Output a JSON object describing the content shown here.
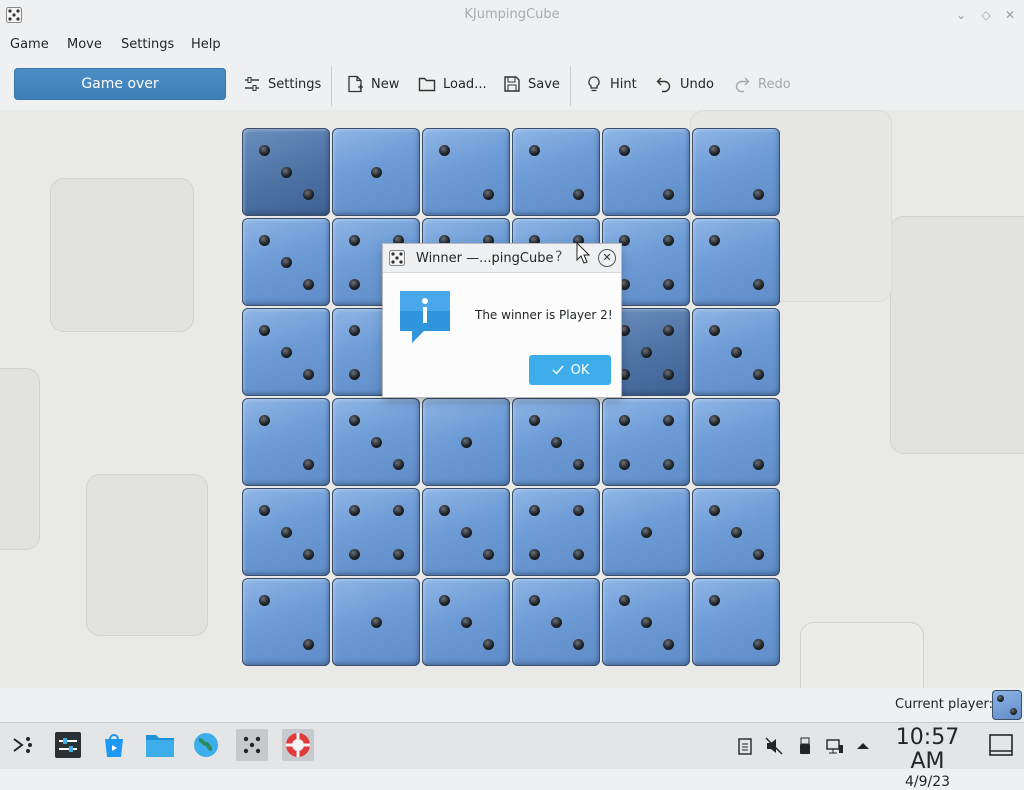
{
  "window": {
    "title": "KJumpingCube"
  },
  "menu": {
    "items": [
      "Game",
      "Move",
      "Settings",
      "Help"
    ]
  },
  "toolbar": {
    "status_button": "Game over",
    "settings": "Settings",
    "new": "New",
    "load": "Load...",
    "save": "Save",
    "hint": "Hint",
    "undo": "Undo",
    "redo": "Redo"
  },
  "board": {
    "size": 6,
    "pips": [
      [
        3,
        1,
        2,
        2,
        2,
        2
      ],
      [
        3,
        4,
        4,
        4,
        4,
        2
      ],
      [
        3,
        4,
        4,
        4,
        5,
        3
      ],
      [
        2,
        3,
        1,
        3,
        4,
        2
      ],
      [
        3,
        4,
        3,
        4,
        1,
        3
      ],
      [
        2,
        1,
        3,
        3,
        3,
        2
      ]
    ],
    "owners": [
      [
        "dark",
        "light",
        "light",
        "light",
        "light",
        "light"
      ],
      [
        "light",
        "light",
        "light",
        "light",
        "light",
        "light"
      ],
      [
        "light",
        "light",
        "light",
        "light",
        "dark",
        "light"
      ],
      [
        "light",
        "light",
        "light",
        "light",
        "light",
        "light"
      ],
      [
        "light",
        "light",
        "light",
        "light",
        "light",
        "light"
      ],
      [
        "light",
        "light",
        "light",
        "light",
        "light",
        "light"
      ]
    ],
    "colors": {
      "light": "#6d9bd6",
      "dark": "#4f74a6"
    }
  },
  "dialog": {
    "title": "Winner —...pingCube",
    "help": "?",
    "message": "The winner is Player 2!",
    "ok": "OK"
  },
  "status": {
    "current_player_label": "Current player:"
  },
  "taskbar": {
    "time": "10:57 AM",
    "date": "4/9/23",
    "launchers": [
      "application-launcher-icon",
      "system-settings-icon",
      "discover-store-icon",
      "file-manager-icon",
      "web-browser-icon",
      "kjumpingcube-icon",
      "ktuberling-help-icon"
    ]
  }
}
